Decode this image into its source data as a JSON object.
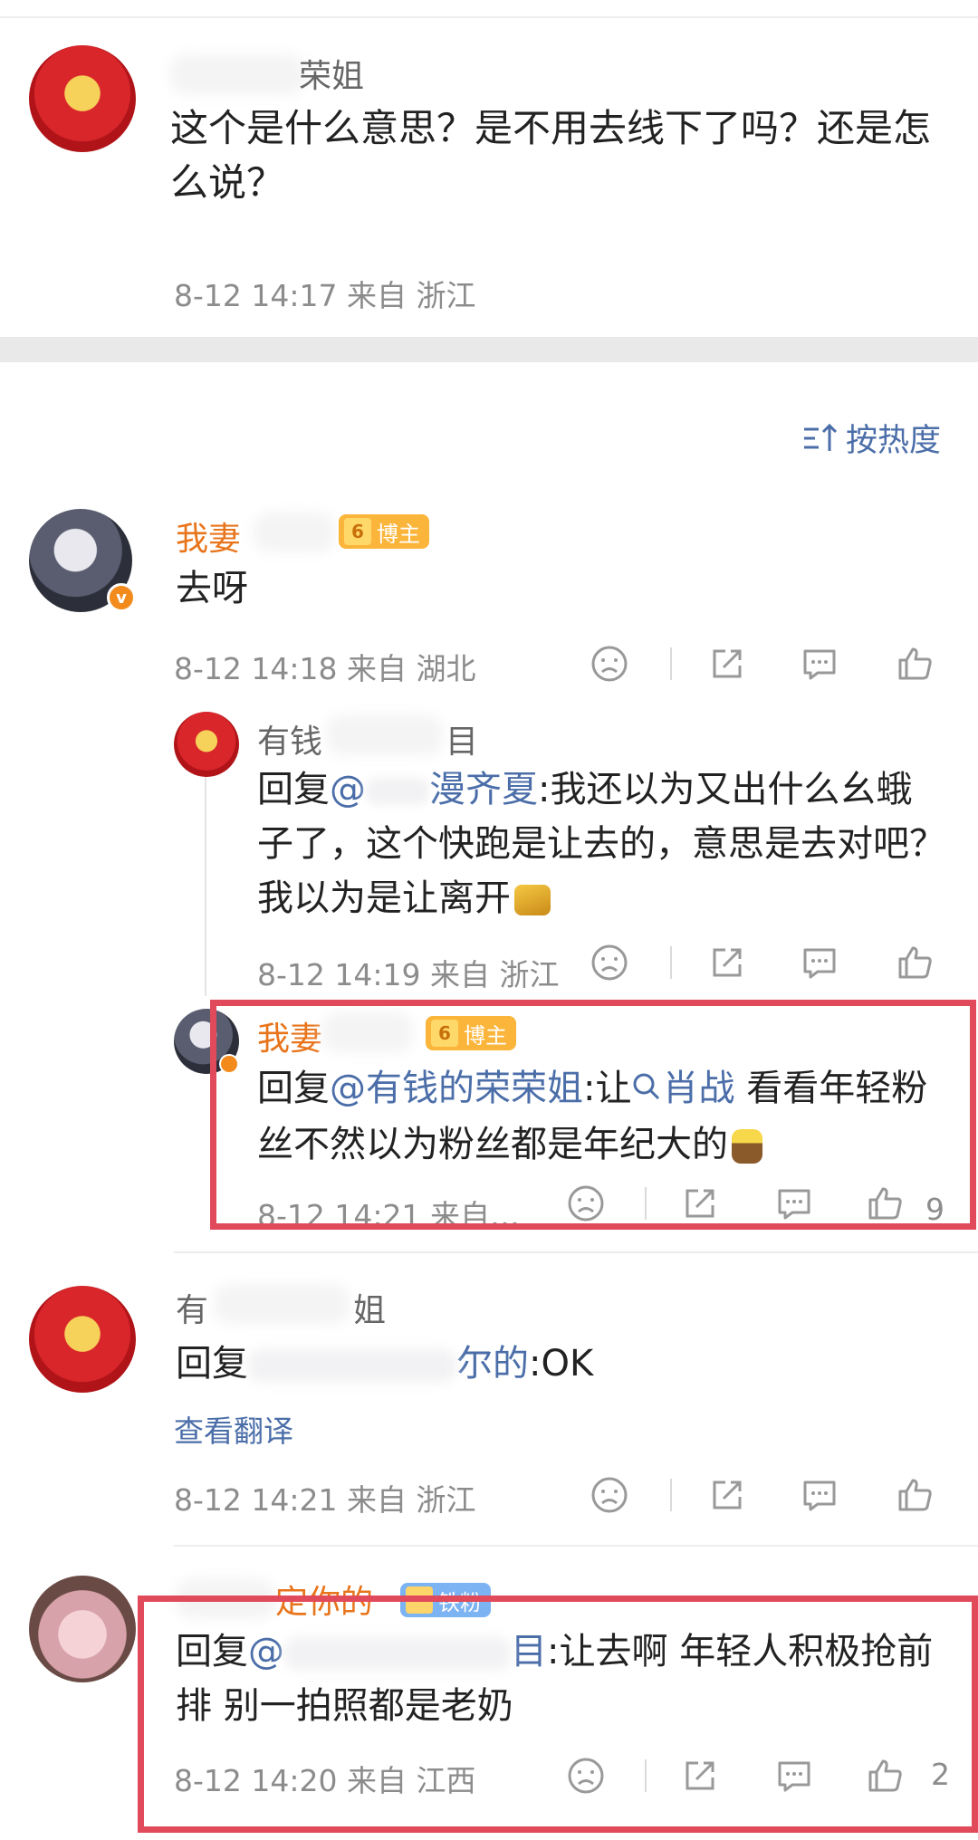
{
  "top_comment": {
    "name_suffix": "荣姐",
    "text": "这个是什么意思？是不用去线下了吗？还是怎么说？",
    "meta": "8-12 14:17 来自 浙江"
  },
  "sort": {
    "label": "按热度"
  },
  "comments": [
    {
      "name": "我妻",
      "badge": "博主",
      "text": "去呀",
      "meta": "8-12 14:18 来自 湖北"
    },
    {
      "name_start": "有钱",
      "name_end": "目",
      "reply_prefix": "回复",
      "mention": "@",
      "mention_name": "漫齐夏",
      "text_after": ":我还以为又出什么幺蛾子了，这个快跑是让去的，意思是去对吧？我以为是让离开",
      "meta": "8-12 14:19 来自 浙江"
    },
    {
      "name": "我妻",
      "badge": "博主",
      "reply_prefix": "回复",
      "mention": "@有钱的荣荣姐",
      "text_mid": ":让",
      "topic": "肖战",
      "text_after": " 看看年轻粉丝不然以为粉丝都是年纪大的",
      "meta": "8-12 14:21 来自…",
      "like_count": "9"
    },
    {
      "name_start": "有",
      "name_end": "姐",
      "reply_prefix": "回复",
      "mention_end": "尔的",
      "text_after": ":OK",
      "translate": "查看翻译",
      "meta": "8-12 14:21 来自 浙江"
    },
    {
      "name": "定你的",
      "badge": "铁粉",
      "reply_prefix": "回复",
      "mention": "@",
      "mention_end": "目",
      "text_after": ":让去啊 年轻人积极抢前排 别一拍照都是老奶",
      "meta": "8-12 14:20 来自 江西",
      "like_count": "2"
    }
  ],
  "colors": {
    "accent_link": "#4b6ea9",
    "name_orange": "#e8741b",
    "highlight_box": "#e04a5b",
    "badge": "#fbb53a"
  },
  "icons": [
    "dislike-icon",
    "share-icon",
    "comment-icon",
    "like-icon",
    "sort-icon"
  ]
}
